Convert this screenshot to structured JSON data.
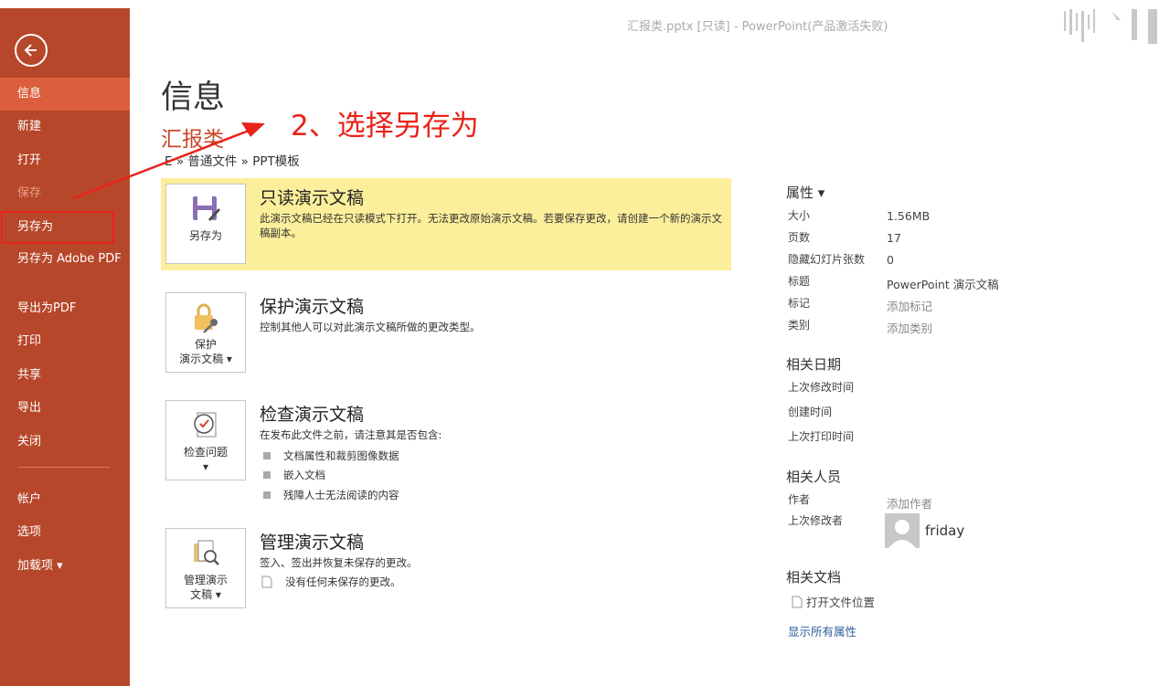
{
  "window": {
    "title": "汇报类.pptx [只读] - PowerPoint(产品激活失败)"
  },
  "sidebar": {
    "items": [
      {
        "label": "信息"
      },
      {
        "label": "新建"
      },
      {
        "label": "打开"
      },
      {
        "label": "保存"
      },
      {
        "label": "另存为"
      },
      {
        "label": "另存为 Adobe PDF"
      },
      {
        "label": "导出为PDF"
      },
      {
        "label": "打印"
      },
      {
        "label": "共享"
      },
      {
        "label": "导出"
      },
      {
        "label": "关闭"
      },
      {
        "label": "帐户"
      },
      {
        "label": "选项"
      },
      {
        "label": "加载项 ▾"
      }
    ]
  },
  "main": {
    "title": "信息",
    "file_name": "汇报类",
    "breadcrumb": "E » 普通文件 » PPT模板",
    "annotation": "2、选择另存为",
    "sections": [
      {
        "button": "另存为",
        "title": "只读演示文稿",
        "desc": "此演示文稿已经在只读模式下打开。无法更改原始演示文稿。若要保存更改，请创建一个新的演示文稿副本。"
      },
      {
        "button_line1": "保护",
        "button_line2": "演示文稿 ▾",
        "title": "保护演示文稿",
        "desc": "控制其他人可以对此演示文稿所做的更改类型。"
      },
      {
        "button": "检查问题",
        "button_chevron": "▾",
        "title": "检查演示文稿",
        "desc": "在发布此文件之前，请注意其是否包含:",
        "bullets": [
          "文档属性和裁剪图像数据",
          "嵌入文档",
          "残障人士无法阅读的内容"
        ]
      },
      {
        "button_line1": "管理演示",
        "button_line2": "文稿 ▾",
        "title": "管理演示文稿",
        "desc": "签入、签出并恢复未保存的更改。",
        "note": "没有任何未保存的更改。"
      }
    ]
  },
  "properties": {
    "header": "属性 ▾",
    "rows": [
      {
        "label": "大小",
        "value": "1.56MB"
      },
      {
        "label": "页数",
        "value": "17"
      },
      {
        "label": "隐藏幻灯片张数",
        "value": "0"
      },
      {
        "label": "标题",
        "value": "PowerPoint 演示文稿"
      },
      {
        "label": "标记",
        "value": "添加标记"
      },
      {
        "label": "类别",
        "value": "添加类别"
      }
    ],
    "dates_header": "相关日期",
    "dates": [
      "上次修改时间",
      "创建时间",
      "上次打印时间"
    ],
    "people_header": "相关人员",
    "author_label": "作者",
    "author_value": "添加作者",
    "modified_by_label": "上次修改者",
    "modified_by_value": "friday",
    "docs_header": "相关文档",
    "open_location": "打开文件位置",
    "show_all": "显示所有属性"
  },
  "colors": {
    "sidebar": "#b7472a",
    "active": "#db5e3d",
    "highlight": "#fcef9b",
    "annotation": "#e8231a"
  }
}
